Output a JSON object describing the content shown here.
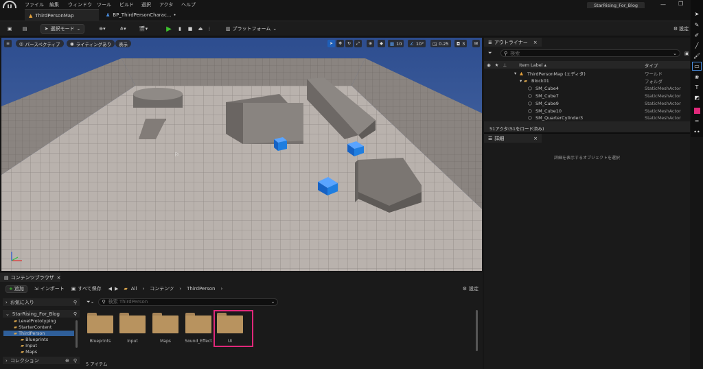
{
  "menu": {
    "items": [
      "ファイル",
      "編集",
      "ウィンドウ",
      "ツール",
      "ビルド",
      "選択",
      "アクタ",
      "ヘルプ"
    ],
    "project_name": "StarRising_For_Blog"
  },
  "tabs": [
    {
      "label": "ThirdPersonMap"
    },
    {
      "label": "BP_ThirdPersonCharac..."
    }
  ],
  "toolbar": {
    "select_mode": "選択モード",
    "platform": "プラットフォーム",
    "settings": "設定"
  },
  "viewport": {
    "perspective": "パースペクティブ",
    "lighting": "ライティングあり",
    "show": "表示",
    "grid_snap": "10",
    "rot_snap": "10°",
    "scale_snap": "0.25",
    "cam_speed": "3"
  },
  "outliner": {
    "title": "アウトライナー",
    "search_placeholder": "検索",
    "col_label": "Item Label ▴",
    "col_type": "タイプ",
    "rows": [
      {
        "label": "ThirdPersonMap (エディタ)",
        "type": "ワールド"
      },
      {
        "label": "Block01",
        "type": "フォルダ"
      },
      {
        "label": "SM_Cube4",
        "type": "StaticMeshActor"
      },
      {
        "label": "SM_Cube7",
        "type": "StaticMeshActor"
      },
      {
        "label": "SM_Cube9",
        "type": "StaticMeshActor"
      },
      {
        "label": "SM_Cube10",
        "type": "StaticMeshActor"
      },
      {
        "label": "SM_QuarterCylinder3",
        "type": "StaticMeshActor"
      }
    ],
    "status": "51アクタ(51をロード済み)"
  },
  "details": {
    "title": "詳細",
    "empty_msg": "詳細を表示するオブジェクトを選択"
  },
  "content_browser": {
    "title": "コンテンツブラウザ",
    "add": "追加",
    "import": "インポート",
    "save_all": "すべて保存",
    "breadcrumb": [
      "All",
      "コンテンツ",
      "ThirdPerson"
    ],
    "settings": "設定",
    "favorites": "お気に入り",
    "search_placeholder": "検索 ThirdPerson",
    "tree": [
      "StarRising_For_Blog",
      "LevelPrototyping",
      "StarterContent",
      "ThirdPerson",
      "Blueprints",
      "Input",
      "Maps"
    ],
    "collections": "コレクション",
    "folders": [
      "Blueprints",
      "Input",
      "Maps",
      "Sound_Effect",
      "UI"
    ],
    "item_count": "5 アイテム"
  },
  "colors": {
    "highlight": "#e0287a",
    "accent_blue": "#1f7ee0",
    "play_green": "#3ec12e"
  }
}
